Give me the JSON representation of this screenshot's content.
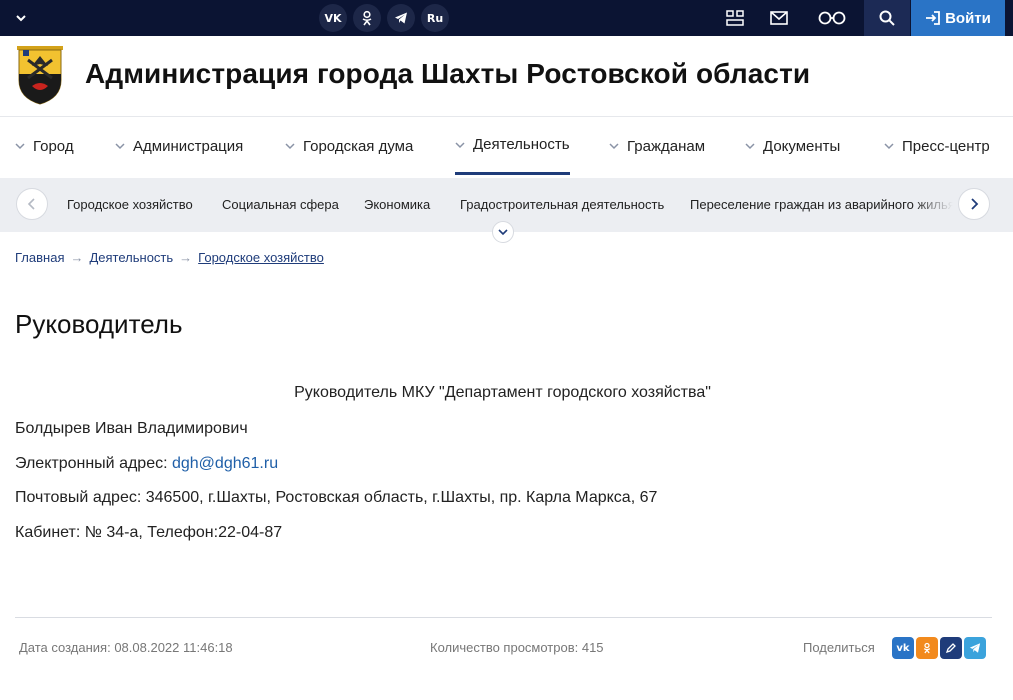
{
  "topbar": {
    "social": [
      {
        "icon": "vk-icon",
        "label": "VK"
      },
      {
        "icon": "odnoklassniki-icon",
        "label": "OK"
      },
      {
        "icon": "telegram-icon",
        "label": ""
      },
      {
        "icon": "language-icon",
        "label": "Ru"
      }
    ],
    "login_label": "Войти",
    "colors": {
      "bar": "#0b1433",
      "login": "#2a74c6"
    }
  },
  "header": {
    "title": "Администрация города Шахты Ростовской области"
  },
  "main_nav": [
    {
      "label": "Город",
      "active": false
    },
    {
      "label": "Администрация",
      "active": false
    },
    {
      "label": "Городская дума",
      "active": false
    },
    {
      "label": "Деятельность",
      "active": true
    },
    {
      "label": "Гражданам",
      "active": false
    },
    {
      "label": "Документы",
      "active": false
    },
    {
      "label": "Пресс-центр",
      "active": false
    }
  ],
  "sub_nav": [
    {
      "label": "Городское хозяйство"
    },
    {
      "label": "Социальная сфера"
    },
    {
      "label": "Экономика"
    },
    {
      "label": "Градостроительная деятельность"
    },
    {
      "label": "Переселение граждан из аварийного жилья"
    }
  ],
  "breadcrumb": {
    "items": [
      "Главная",
      "Деятельность",
      "Городское хозяйство"
    ],
    "separator": "→"
  },
  "page": {
    "title": "Руководитель",
    "heading": "Руководитель МКУ \"Департамент городского хозяйства\"",
    "name": "Болдырев Иван Владимирович",
    "email_label": "Электронный адрес: ",
    "email": "dgh@dgh61.ru",
    "postal": "Почтовый адрес: 346500, г.Шахты, Ростовская область, г.Шахты, пр. Карла Маркса, 67",
    "office": "Кабинет: № 34-а, Телефон:22-04-87"
  },
  "footer": {
    "created": "Дата создания: 08.08.2022 11:46:18",
    "views": "Количество просмотров: 415",
    "share_label": "Поделиться",
    "share_buttons": [
      {
        "icon": "vk-icon",
        "color": "#2a74c6"
      },
      {
        "icon": "odnoklassniki-icon",
        "color": "#f28a1d"
      },
      {
        "icon": "pen-icon",
        "color": "#1f3c7a"
      },
      {
        "icon": "telegram-icon",
        "color": "#3ba3dc"
      }
    ]
  }
}
